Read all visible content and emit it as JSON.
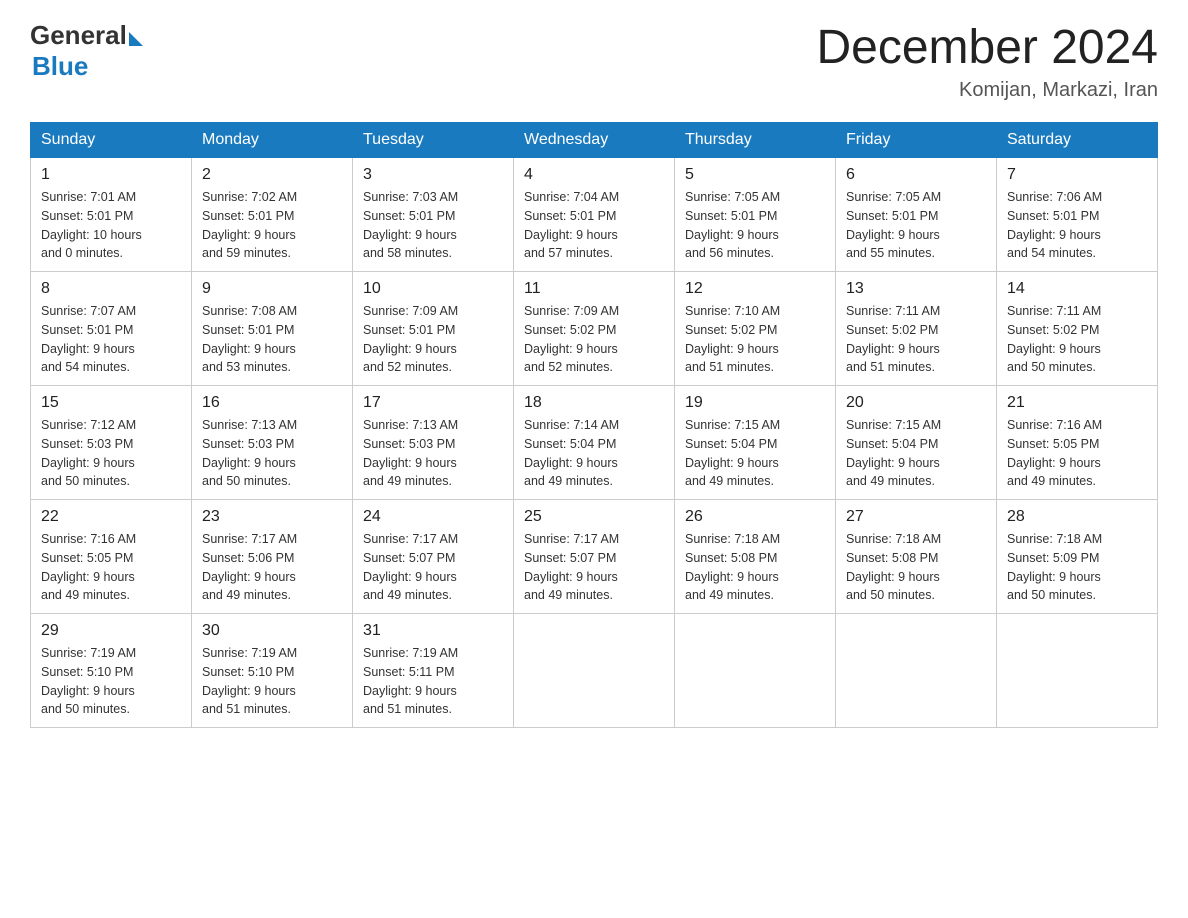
{
  "header": {
    "logo_general": "General",
    "logo_blue": "Blue",
    "month_year": "December 2024",
    "location": "Komijan, Markazi, Iran"
  },
  "weekdays": [
    "Sunday",
    "Monday",
    "Tuesday",
    "Wednesday",
    "Thursday",
    "Friday",
    "Saturday"
  ],
  "weeks": [
    [
      {
        "day": "1",
        "sunrise": "7:01 AM",
        "sunset": "5:01 PM",
        "daylight": "10 hours and 0 minutes."
      },
      {
        "day": "2",
        "sunrise": "7:02 AM",
        "sunset": "5:01 PM",
        "daylight": "9 hours and 59 minutes."
      },
      {
        "day": "3",
        "sunrise": "7:03 AM",
        "sunset": "5:01 PM",
        "daylight": "9 hours and 58 minutes."
      },
      {
        "day": "4",
        "sunrise": "7:04 AM",
        "sunset": "5:01 PM",
        "daylight": "9 hours and 57 minutes."
      },
      {
        "day": "5",
        "sunrise": "7:05 AM",
        "sunset": "5:01 PM",
        "daylight": "9 hours and 56 minutes."
      },
      {
        "day": "6",
        "sunrise": "7:05 AM",
        "sunset": "5:01 PM",
        "daylight": "9 hours and 55 minutes."
      },
      {
        "day": "7",
        "sunrise": "7:06 AM",
        "sunset": "5:01 PM",
        "daylight": "9 hours and 54 minutes."
      }
    ],
    [
      {
        "day": "8",
        "sunrise": "7:07 AM",
        "sunset": "5:01 PM",
        "daylight": "9 hours and 54 minutes."
      },
      {
        "day": "9",
        "sunrise": "7:08 AM",
        "sunset": "5:01 PM",
        "daylight": "9 hours and 53 minutes."
      },
      {
        "day": "10",
        "sunrise": "7:09 AM",
        "sunset": "5:01 PM",
        "daylight": "9 hours and 52 minutes."
      },
      {
        "day": "11",
        "sunrise": "7:09 AM",
        "sunset": "5:02 PM",
        "daylight": "9 hours and 52 minutes."
      },
      {
        "day": "12",
        "sunrise": "7:10 AM",
        "sunset": "5:02 PM",
        "daylight": "9 hours and 51 minutes."
      },
      {
        "day": "13",
        "sunrise": "7:11 AM",
        "sunset": "5:02 PM",
        "daylight": "9 hours and 51 minutes."
      },
      {
        "day": "14",
        "sunrise": "7:11 AM",
        "sunset": "5:02 PM",
        "daylight": "9 hours and 50 minutes."
      }
    ],
    [
      {
        "day": "15",
        "sunrise": "7:12 AM",
        "sunset": "5:03 PM",
        "daylight": "9 hours and 50 minutes."
      },
      {
        "day": "16",
        "sunrise": "7:13 AM",
        "sunset": "5:03 PM",
        "daylight": "9 hours and 50 minutes."
      },
      {
        "day": "17",
        "sunrise": "7:13 AM",
        "sunset": "5:03 PM",
        "daylight": "9 hours and 49 minutes."
      },
      {
        "day": "18",
        "sunrise": "7:14 AM",
        "sunset": "5:04 PM",
        "daylight": "9 hours and 49 minutes."
      },
      {
        "day": "19",
        "sunrise": "7:15 AM",
        "sunset": "5:04 PM",
        "daylight": "9 hours and 49 minutes."
      },
      {
        "day": "20",
        "sunrise": "7:15 AM",
        "sunset": "5:04 PM",
        "daylight": "9 hours and 49 minutes."
      },
      {
        "day": "21",
        "sunrise": "7:16 AM",
        "sunset": "5:05 PM",
        "daylight": "9 hours and 49 minutes."
      }
    ],
    [
      {
        "day": "22",
        "sunrise": "7:16 AM",
        "sunset": "5:05 PM",
        "daylight": "9 hours and 49 minutes."
      },
      {
        "day": "23",
        "sunrise": "7:17 AM",
        "sunset": "5:06 PM",
        "daylight": "9 hours and 49 minutes."
      },
      {
        "day": "24",
        "sunrise": "7:17 AM",
        "sunset": "5:07 PM",
        "daylight": "9 hours and 49 minutes."
      },
      {
        "day": "25",
        "sunrise": "7:17 AM",
        "sunset": "5:07 PM",
        "daylight": "9 hours and 49 minutes."
      },
      {
        "day": "26",
        "sunrise": "7:18 AM",
        "sunset": "5:08 PM",
        "daylight": "9 hours and 49 minutes."
      },
      {
        "day": "27",
        "sunrise": "7:18 AM",
        "sunset": "5:08 PM",
        "daylight": "9 hours and 50 minutes."
      },
      {
        "day": "28",
        "sunrise": "7:18 AM",
        "sunset": "5:09 PM",
        "daylight": "9 hours and 50 minutes."
      }
    ],
    [
      {
        "day": "29",
        "sunrise": "7:19 AM",
        "sunset": "5:10 PM",
        "daylight": "9 hours and 50 minutes."
      },
      {
        "day": "30",
        "sunrise": "7:19 AM",
        "sunset": "5:10 PM",
        "daylight": "9 hours and 51 minutes."
      },
      {
        "day": "31",
        "sunrise": "7:19 AM",
        "sunset": "5:11 PM",
        "daylight": "9 hours and 51 minutes."
      },
      null,
      null,
      null,
      null
    ]
  ],
  "labels": {
    "sunrise": "Sunrise:",
    "sunset": "Sunset:",
    "daylight": "Daylight:"
  }
}
